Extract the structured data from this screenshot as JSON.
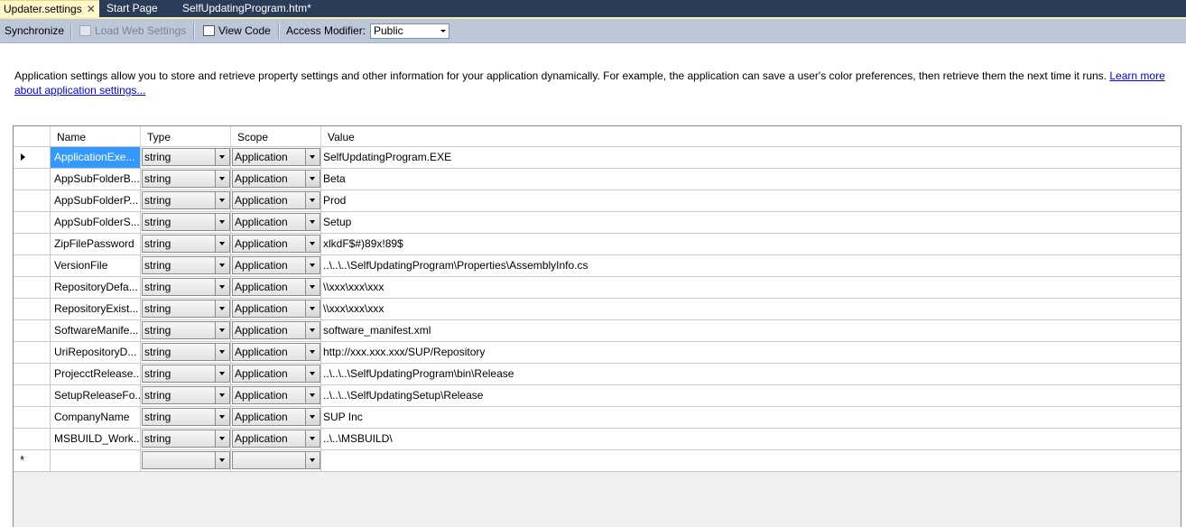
{
  "tabs": [
    {
      "label": "Updater.settings",
      "active": true
    },
    {
      "label": "Start Page",
      "active": false
    },
    {
      "label": "SelfUpdatingProgram.htm*",
      "active": false
    }
  ],
  "toolbar": {
    "synchronize": "Synchronize",
    "load_web_settings": "Load Web Settings",
    "view_code": "View Code",
    "access_modifier_label": "Access Modifier:",
    "access_modifier_value": "Public"
  },
  "description": {
    "text": "Application settings allow you to store and retrieve property settings and other information for your application dynamically. For example, the application can save a user's color preferences, then retrieve them the next time it runs.",
    "link": "Learn more about application settings..."
  },
  "grid": {
    "columns": [
      "Name",
      "Type",
      "Scope",
      "Value"
    ],
    "rows": [
      {
        "name": "ApplicationExe...",
        "type": "string",
        "scope": "Application",
        "value": "SelfUpdatingProgram.EXE"
      },
      {
        "name": "AppSubFolderB...",
        "type": "string",
        "scope": "Application",
        "value": "Beta"
      },
      {
        "name": "AppSubFolderP...",
        "type": "string",
        "scope": "Application",
        "value": "Prod"
      },
      {
        "name": "AppSubFolderS...",
        "type": "string",
        "scope": "Application",
        "value": "Setup"
      },
      {
        "name": "ZipFilePassword",
        "type": "string",
        "scope": "Application",
        "value": "xlkdF$#)89x!89$"
      },
      {
        "name": "VersionFile",
        "type": "string",
        "scope": "Application",
        "value": "..\\..\\..\\SelfUpdatingProgram\\Properties\\AssemblyInfo.cs"
      },
      {
        "name": "RepositoryDefa...",
        "type": "string",
        "scope": "Application",
        "value": "\\\\xxx\\xxx\\xxx"
      },
      {
        "name": "RepositoryExist...",
        "type": "string",
        "scope": "Application",
        "value": "\\\\xxx\\xxx\\xxx"
      },
      {
        "name": "SoftwareManife...",
        "type": "string",
        "scope": "Application",
        "value": "software_manifest.xml"
      },
      {
        "name": "UriRepositoryD...",
        "type": "string",
        "scope": "Application",
        "value": "http://xxx.xxx.xxx/SUP/Repository"
      },
      {
        "name": "ProjecctRelease...",
        "type": "string",
        "scope": "Application",
        "value": "..\\..\\..\\SelfUpdatingProgram\\bin\\Release"
      },
      {
        "name": "SetupReleaseFo...",
        "type": "string",
        "scope": "Application",
        "value": "..\\..\\..\\SelfUpdatingSetup\\Release"
      },
      {
        "name": "CompanyName",
        "type": "string",
        "scope": "Application",
        "value": "SUP Inc"
      },
      {
        "name": "MSBUILD_Work...",
        "type": "string",
        "scope": "Application",
        "value": "..\\..\\MSBUILD\\"
      }
    ],
    "new_row_marker": "*"
  }
}
